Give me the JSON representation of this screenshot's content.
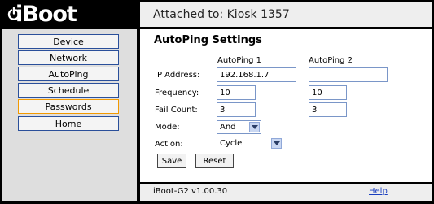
{
  "brand": {
    "logo": "iBoot"
  },
  "header": {
    "attached": "Attached to: Kiosk 1357"
  },
  "sidebar": {
    "items": [
      {
        "label": "Device"
      },
      {
        "label": "Network"
      },
      {
        "label": "AutoPing"
      },
      {
        "label": "Schedule"
      },
      {
        "label": "Passwords",
        "active": true
      },
      {
        "label": "Home"
      }
    ]
  },
  "main": {
    "title": "AutoPing Settings",
    "columns": [
      "AutoPing 1",
      "AutoPing 2"
    ],
    "labels": {
      "ip": "IP Address:",
      "frequency": "Frequency:",
      "fail_count": "Fail Count:",
      "mode": "Mode:",
      "action": "Action:"
    },
    "autoping1": {
      "ip": "192.168.1.7",
      "frequency": "10",
      "fail_count": "3",
      "mode": "And",
      "action": "Cycle"
    },
    "autoping2": {
      "ip": "",
      "frequency": "10",
      "fail_count": "3"
    },
    "buttons": {
      "save": "Save",
      "reset": "Reset"
    }
  },
  "footer": {
    "version": "iBoot-G2 v1.00.30",
    "help": "Help"
  },
  "colors": {
    "frame": "#000000",
    "header_bg": "#eeeeee",
    "sidebar_bg": "#dedede",
    "nav_border": "#2a4f9a",
    "nav_active_border": "#f29900",
    "link": "#1a3fbf"
  },
  "icons": {
    "logo_icon": "power-icon",
    "select_arrow": "chevron-down-icon"
  }
}
